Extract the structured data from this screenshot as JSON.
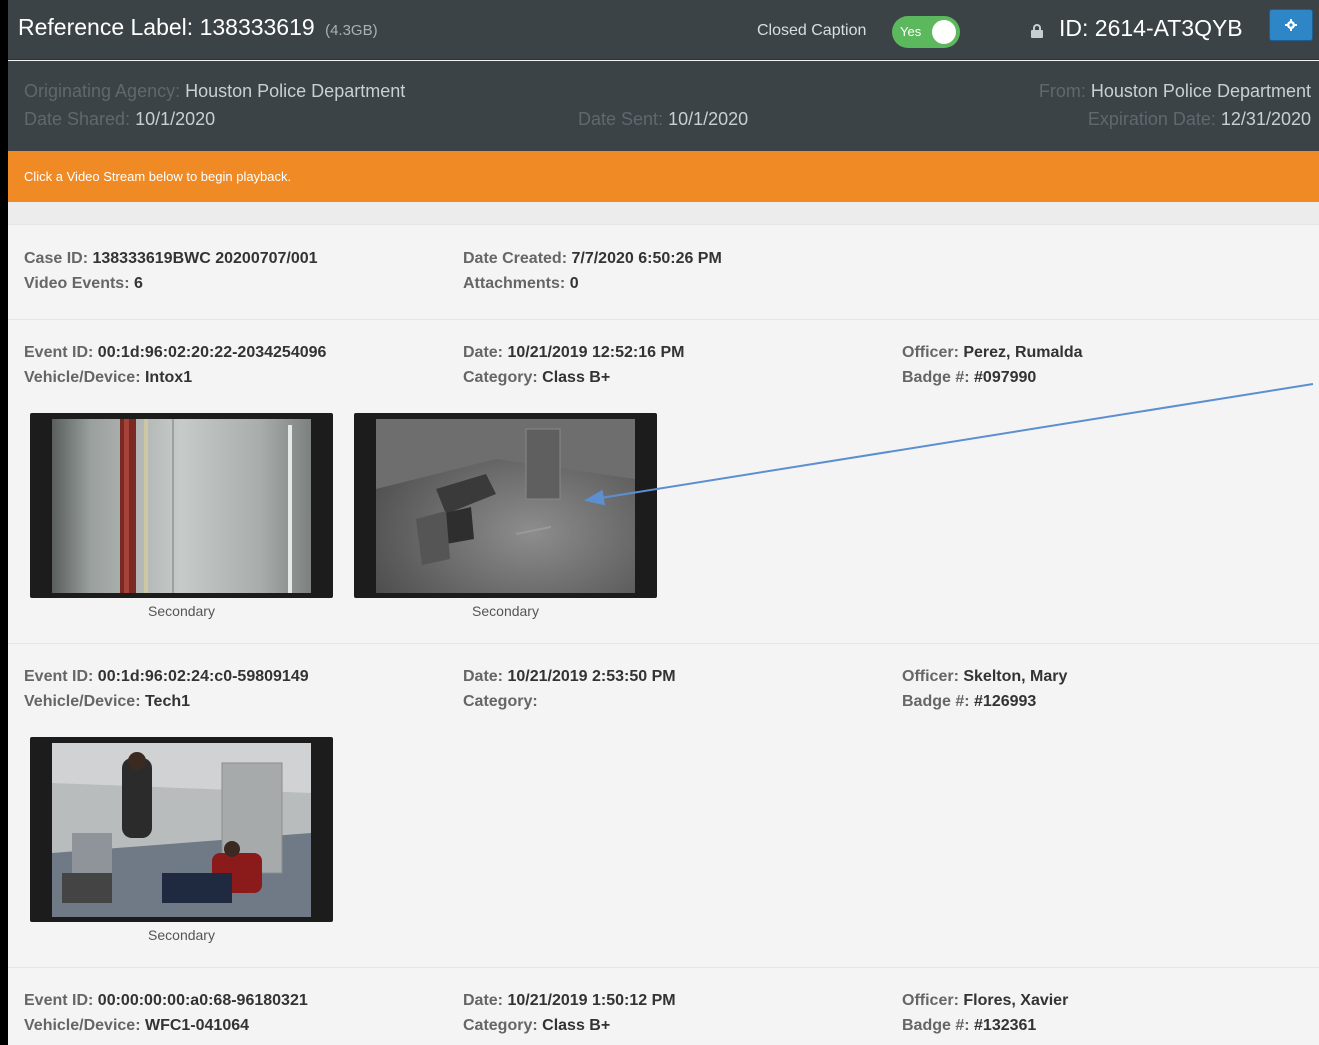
{
  "header": {
    "ref_label": "Reference Label: 138333619",
    "ref_size": "(4.3GB)",
    "closed_caption_label": "Closed Caption",
    "toggle_text": "Yes",
    "id_label": "ID: 2614-AT3QYB"
  },
  "info": {
    "originating_agency_key": "Originating Agency:",
    "originating_agency_value": "Houston Police Department",
    "date_shared_key": "Date Shared:",
    "date_shared_value": "10/1/2020",
    "date_sent_key": "Date Sent:",
    "date_sent_value": "10/1/2020",
    "from_key": "From:",
    "from_value": "Houston Police Department",
    "expiration_key": "Expiration Date:",
    "expiration_value": "12/31/2020"
  },
  "notice": "Click a Video Stream below to begin playback.",
  "case": {
    "case_id_key": "Case ID:",
    "case_id_value": "138333619BWC 20200707/001",
    "video_events_key": "Video Events:",
    "video_events_value": "6",
    "date_created_key": "Date Created:",
    "date_created_value": "7/7/2020 6:50:26 PM",
    "attachments_key": "Attachments:",
    "attachments_value": "0"
  },
  "labels": {
    "event_id": "Event ID:",
    "vehicle": "Vehicle/Device:",
    "date": "Date:",
    "category": "Category:",
    "officer": "Officer:",
    "badge": "Badge #:"
  },
  "events": [
    {
      "event_id": "00:1d:96:02:20:22-2034254096",
      "vehicle": "Intox1",
      "date": "10/21/2019 12:52:16 PM",
      "category": "Class B+",
      "officer": "Perez, Rumalda",
      "badge": "#097990",
      "thumb_captions": [
        "Secondary",
        "Secondary"
      ]
    },
    {
      "event_id": "00:1d:96:02:24:c0-59809149",
      "vehicle": "Tech1",
      "date": "10/21/2019 2:53:50 PM",
      "category": "",
      "officer": "Skelton, Mary",
      "badge": "#126993",
      "thumb_captions": [
        "Secondary"
      ]
    },
    {
      "event_id": "00:00:00:00:a0:68-96180321",
      "vehicle": "WFC1-041064",
      "date": "10/21/2019 1:50:12 PM",
      "category": "Class B+",
      "officer": "Flores, Xavier",
      "badge": "#132361"
    }
  ],
  "colors": {
    "header_bg": "#3b4347",
    "notice_bg": "#f08a24",
    "toggle_on": "#5cb85c",
    "gear_button": "#2e86c7",
    "annotation_arrow": "#5b8fd0"
  }
}
